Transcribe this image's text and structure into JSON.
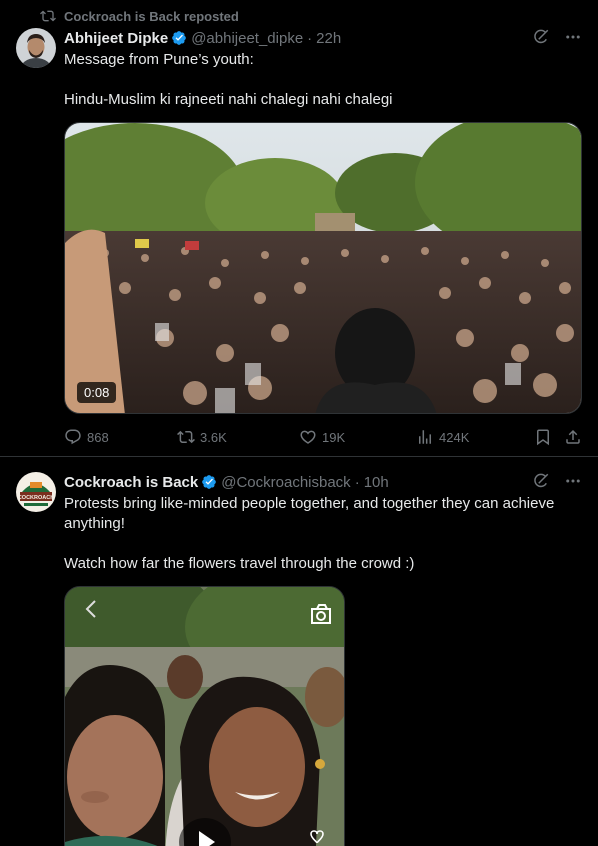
{
  "post1": {
    "repost_label": "Cockroach is Back reposted",
    "author_name": "Abhijeet Dipke",
    "handle": "@abhijeet_dipke",
    "separator": "·",
    "time": "22h",
    "text_lines": [
      "Message from Pune’s youth:",
      "",
      "Hindu-Muslim ki rajneeti nahi chalegi nahi chalegi"
    ],
    "video_duration": "0:08",
    "stats": {
      "replies": "868",
      "reposts": "3.6K",
      "likes": "19K",
      "views": "424K"
    }
  },
  "post2": {
    "author_name": "Cockroach is Back",
    "handle": "@Cockroachisback",
    "separator": "·",
    "time": "10h",
    "text_lines": [
      "Protests bring like-minded people together, and together they can achieve",
      "anything!",
      "",
      "Watch how far the flowers travel through the crowd :)"
    ],
    "avatar_logo_text": "COCKROACH"
  },
  "colors": {
    "background": "#000000",
    "text": "#e7e9ea",
    "muted": "#71767b",
    "verified": "#1d9bf0",
    "divider": "#2f3336"
  }
}
